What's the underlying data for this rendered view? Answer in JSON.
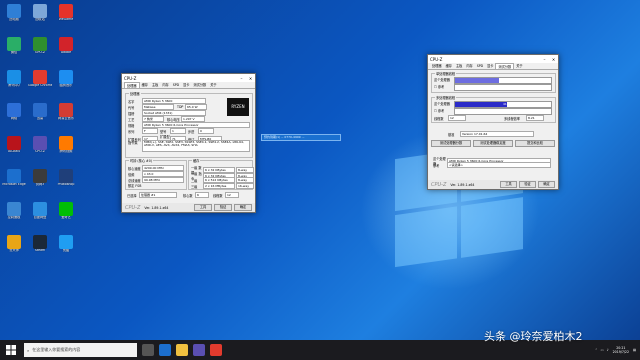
{
  "desktop": {
    "icons": [
      {
        "label": "此电脑",
        "color": "#2f7fd6"
      },
      {
        "label": "微信",
        "color": "#2aae67"
      },
      {
        "label": "腾讯QQ",
        "color": "#1a8fe6"
      },
      {
        "label": "网络",
        "color": "#2d6fd8"
      },
      {
        "label": "AIDA64",
        "color": "#b8141b"
      },
      {
        "label": "Microsoft Edge",
        "color": "#1c6fce"
      },
      {
        "label": "控制面板",
        "color": "#3a86d2"
      },
      {
        "label": "鲁大师",
        "color": "#e8a516"
      },
      {
        "label": "回收站",
        "color": "#7da7d8"
      },
      {
        "label": "GPU-Z",
        "color": "#2f8f2f"
      },
      {
        "label": "Google Chrome",
        "color": "#e23b2e"
      },
      {
        "label": "迅雷",
        "color": "#2a6ccb"
      },
      {
        "label": "CPU-Z",
        "color": "#5a4fb2"
      },
      {
        "label": "剑网3",
        "color": "#3b3b3b"
      },
      {
        "label": "百度网盘",
        "color": "#2c8fe0"
      },
      {
        "label": "Steam",
        "color": "#1b2838"
      },
      {
        "label": "WeGame",
        "color": "#e5332a"
      },
      {
        "label": "Adobe",
        "color": "#d2232a"
      },
      {
        "label": "酷狗音乐",
        "color": "#1d8ef1"
      },
      {
        "label": "网易云音乐",
        "color": "#d43c33"
      },
      {
        "label": "腾讯视频",
        "color": "#ff7a00"
      },
      {
        "label": "Photoshop",
        "color": "#1f3f7a"
      },
      {
        "label": "爱奇艺",
        "color": "#00be06"
      },
      {
        "label": "优酷",
        "color": "#1f9ef2"
      }
    ]
  },
  "cpuz_main": {
    "title": "CPU-Z",
    "tabs": [
      "处理器",
      "缓存",
      "主板",
      "内存",
      "SPD",
      "显卡",
      "测试分数",
      "关于"
    ],
    "group_processor": "处理器",
    "labels": {
      "name": "名字",
      "codename": "代号",
      "package": "插槽",
      "tech": "工艺",
      "spec": "规格",
      "family": "系列",
      "ext_family": "扩展系列",
      "instructions": "指令集",
      "model": "型号",
      "stepping": "步进",
      "ext_model": "扩展型号",
      "revision": "修订",
      "core_voltage": "核心电压",
      "max_tdp": "TDP"
    },
    "values": {
      "name": "AMD Ryzen 5 3600",
      "codename": "Matisse",
      "max_tdp": "65.0 W",
      "package": "Socket AM4 (1331)",
      "tech": "7 纳米",
      "core_voltage": "1.297 V",
      "spec": "AMD Ryzen 5 3600 6-Core Processor",
      "family": "F",
      "model": "1",
      "stepping": "0",
      "ext_family": "17",
      "ext_model": "71",
      "revision": "MTS-B0",
      "instructions": "MMX(+), SSE, SSE2, SSE3, SSSE3, SSE4.1, SSE4.2, SSE4A, x86-64, AMD-V, AES, AVX, AVX2, FMA3, SHA"
    },
    "clocks_group": "时钟 (核心 #0)",
    "cache_group": "缓存",
    "clocks": {
      "core_speed_label": "核心速度",
      "core_speed": "4299.00 MHz",
      "mult_label": "倍频",
      "mult": "x 43.0",
      "bus_label": "总线速度",
      "bus": "99.98 MHz",
      "fsb_label": "额定 FSB",
      "l1d_label": "一级 数据",
      "l1d": "6 x 32 KBytes",
      "l1d_way": "8-way",
      "l1i_label": "一级 指令",
      "l1i": "6 x 32 KBytes",
      "l1i_way": "8-way",
      "l2_label": "二级",
      "l2": "6 x 512 KBytes",
      "l2_way": "8-way",
      "l3_label": "三级",
      "l3": "2 x 16 MBytes",
      "l3_way": "16-way"
    },
    "selection_label": "已选择",
    "selection": "处理器 #1",
    "cores_label": "核心数",
    "cores": "6",
    "threads_label": "线程数",
    "threads": "12",
    "footer": {
      "brand": "CPU-Z",
      "version": "Ver. 1.89.1.x64",
      "tools": "工具",
      "validate": "验证",
      "ok": "确定"
    }
  },
  "cpuz_bench": {
    "title": "CPU-Z",
    "tabs": [
      "处理器",
      "缓存",
      "主板",
      "内存",
      "SPD",
      "显卡",
      "测试分数",
      "关于"
    ],
    "single_group": "单处理器线程",
    "single_this": "这个处理器",
    "single_ref": "参考",
    "single_value": "531.4",
    "multi_group": "多处理器线程",
    "multi_this": "这个处理器",
    "multi_ref": "参考",
    "multi_value": "4111.5",
    "threads_label": "线程数",
    "threads": "12",
    "ratio_label": "多线程倍率",
    "ratio": "8.21",
    "base_label": "基准",
    "base": "Version 17.01.64",
    "btn_bench_cpu": "测试处理器分数",
    "btn_stress_cpu": "测试处理器稳定度",
    "btn_submit": "提交和比较",
    "this_cpu_label": "这个处理器",
    "this_cpu": "AMD Ryzen 5 3600 6-Core Processor",
    "ref_label": "参考",
    "ref": "<请选择>",
    "footer": {
      "brand": "CPU-Z",
      "version": "Ver. 1.89.1.x64",
      "tools": "工具",
      "validate": "验证",
      "ok": "确定"
    }
  },
  "tooltip": "预约到期(1) -- 0770-4999 ...",
  "taskbar": {
    "search_placeholder": "在这里输入你要搜索的内容",
    "clock_time": "20:21",
    "clock_date": "2019/7/22"
  },
  "watermark": "头条 @玲奈爱柏木2"
}
